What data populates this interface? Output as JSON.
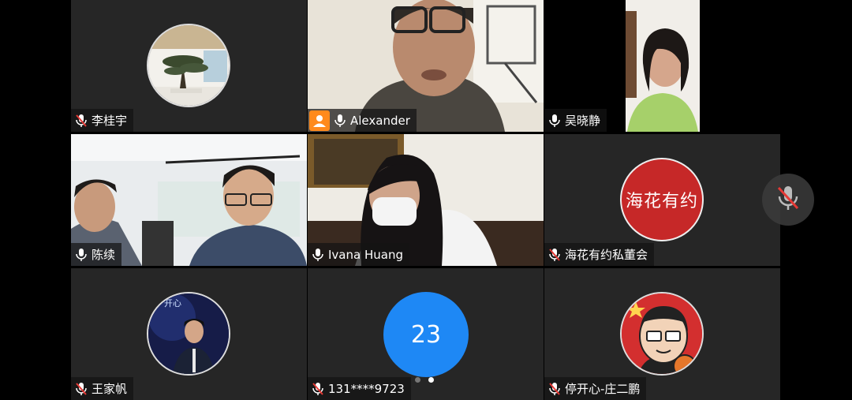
{
  "participants": [
    {
      "name": "李桂宇",
      "muted": true
    },
    {
      "name": "Alexander",
      "muted": false,
      "host": true
    },
    {
      "name": "吴晓静",
      "muted": false
    },
    {
      "name": "陈续",
      "muted": false
    },
    {
      "name": "Ivana Huang",
      "muted": false
    },
    {
      "name": "海花有约私董会",
      "muted": true,
      "avatar_text": "海花有约"
    },
    {
      "name": "王家帆",
      "muted": true,
      "avatar_caption": "开心"
    },
    {
      "name": "131****9723",
      "muted": true,
      "count": "23"
    },
    {
      "name": "停开心-庄二鹏",
      "muted": true
    }
  ],
  "pagination": {
    "pages": 2,
    "current": 2
  },
  "self_mic": {
    "muted": true
  },
  "colors": {
    "active_border": "#2db34a",
    "count_circle": "#1e88f5",
    "muted_red": "#e53935",
    "haihua_bg": "#c62828"
  }
}
